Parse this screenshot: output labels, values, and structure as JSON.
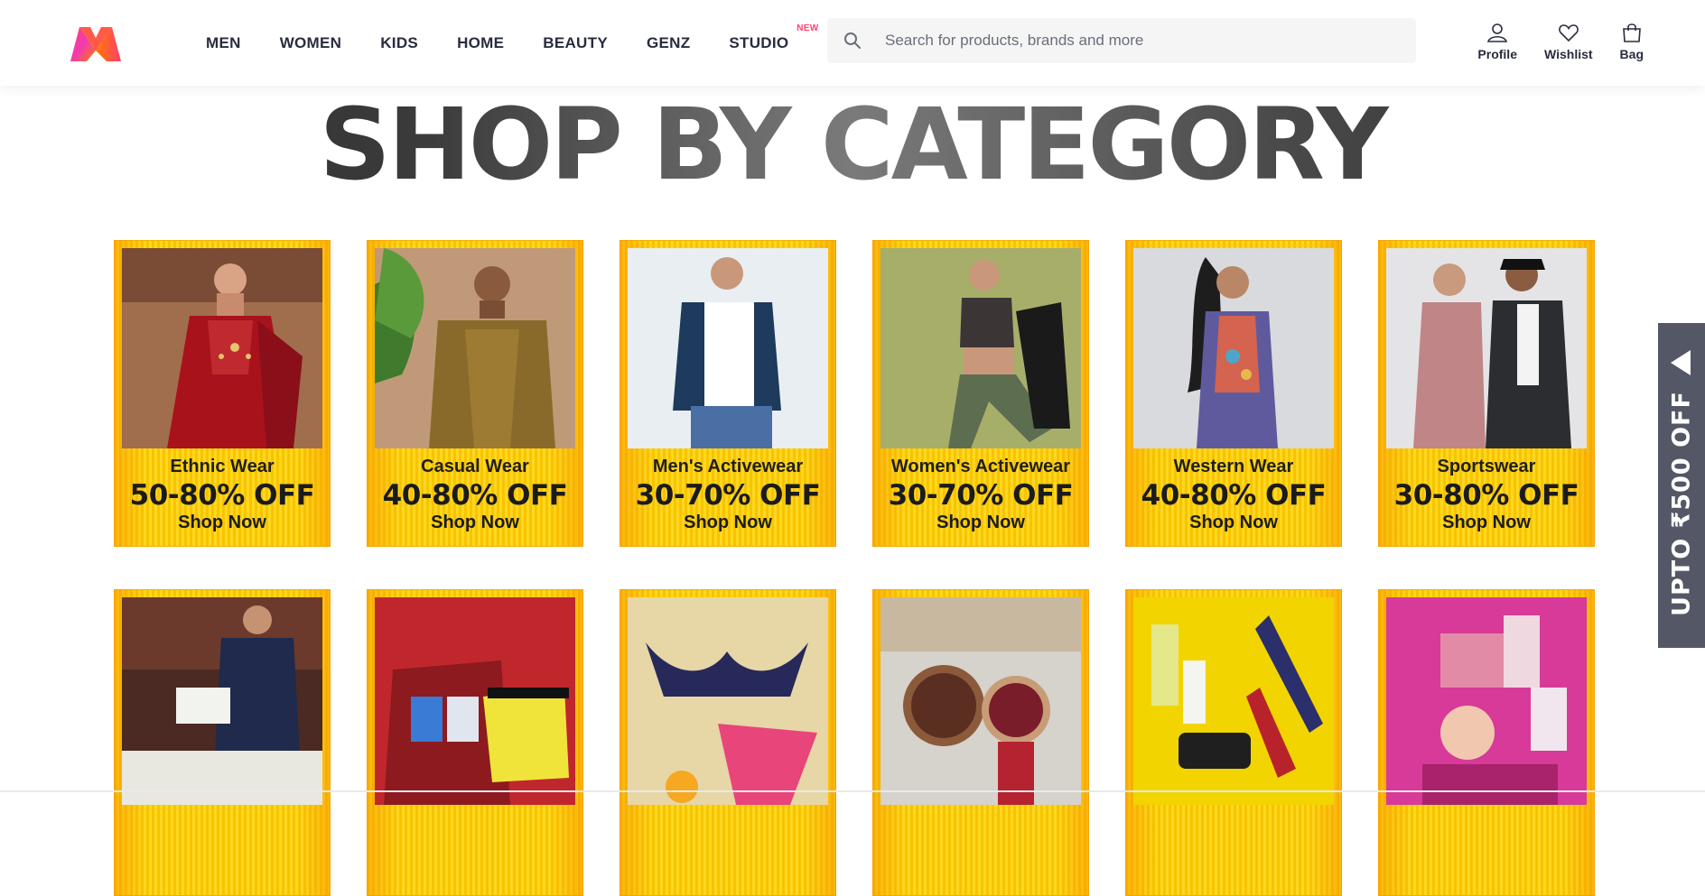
{
  "header": {
    "nav": [
      {
        "label": "MEN"
      },
      {
        "label": "WOMEN"
      },
      {
        "label": "KIDS"
      },
      {
        "label": "HOME"
      },
      {
        "label": "BEAUTY"
      },
      {
        "label": "GENZ"
      },
      {
        "label": "STUDIO",
        "badge": "NEW"
      }
    ],
    "search_placeholder": "Search for products, brands and more",
    "actions": {
      "profile": "Profile",
      "wishlist": "Wishlist",
      "bag": "Bag"
    }
  },
  "section_title": "SHOP BY CATEGORY",
  "categories": [
    {
      "name": "Ethnic Wear",
      "offer": "50-80% OFF",
      "cta": "Shop Now"
    },
    {
      "name": "Casual Wear",
      "offer": "40-80% OFF",
      "cta": "Shop Now"
    },
    {
      "name": "Men's Activewear",
      "offer": "30-70% OFF",
      "cta": "Shop Now"
    },
    {
      "name": "Women's Activewear",
      "offer": "30-70% OFF",
      "cta": "Shop Now"
    },
    {
      "name": "Western Wear",
      "offer": "40-80% OFF",
      "cta": "Shop Now"
    },
    {
      "name": "Sportswear",
      "offer": "30-80% OFF",
      "cta": "Shop Now"
    }
  ],
  "side_tab": {
    "label": "UPTO ₹500 OFF"
  },
  "colors": {
    "brand_pink": "#ff3f6c",
    "banner_yellow": "#f7c400",
    "side_tab": "#535766"
  }
}
